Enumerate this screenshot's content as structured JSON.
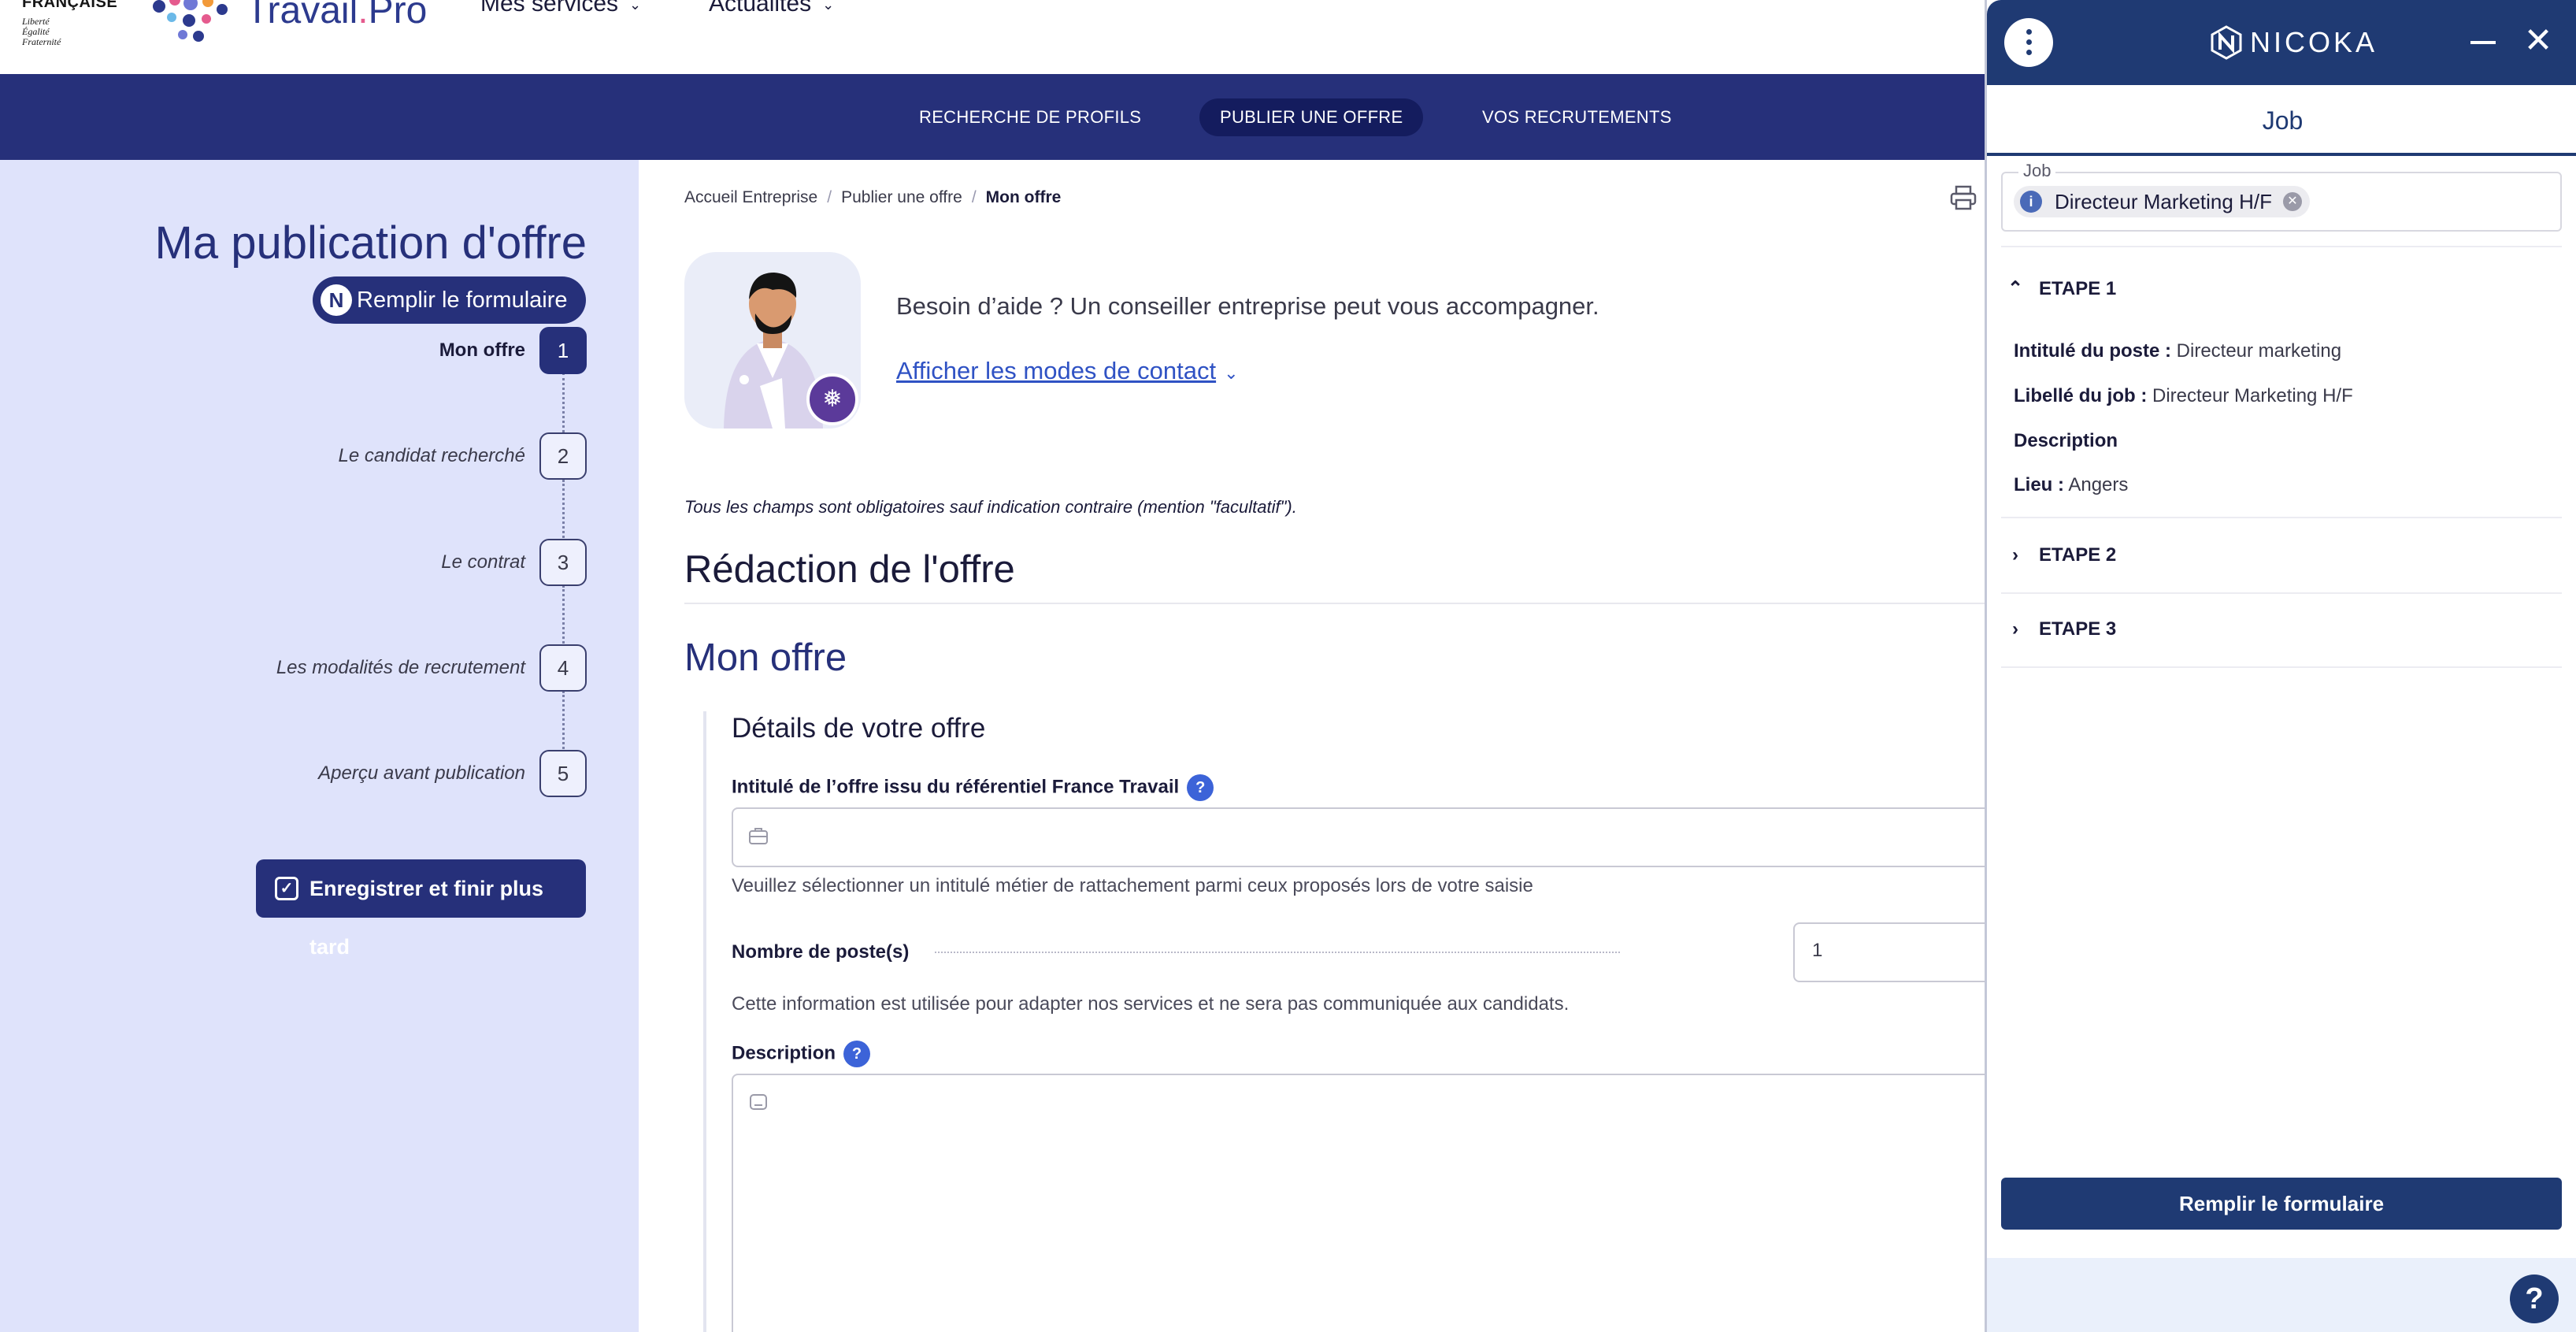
{
  "header": {
    "republic": "FRANÇAISE",
    "motto": [
      "Liberté",
      "Égalité",
      "Fraternité"
    ],
    "logo_text": "Travail",
    "logo_dot": ".",
    "logo_suffix": "Pro",
    "menus": [
      {
        "label": "Mes services"
      },
      {
        "label": "Actualités"
      }
    ]
  },
  "navbar": {
    "items": [
      {
        "label": "RECHERCHE DE PROFILS"
      },
      {
        "label": "PUBLIER UNE OFFRE"
      },
      {
        "label": "VOS RECRUTEMENTS"
      }
    ]
  },
  "sidebar": {
    "title": "Ma publication d'offre",
    "fill_button": "Remplir le formulaire",
    "steps": [
      {
        "label": "Mon offre",
        "num": "1"
      },
      {
        "label": "Le candidat recherché",
        "num": "2"
      },
      {
        "label": "Le contrat",
        "num": "3"
      },
      {
        "label": "Les modalités de recrutement",
        "num": "4"
      },
      {
        "label": "Aperçu avant publication",
        "num": "5"
      }
    ],
    "save_button": "Enregistrer et finir plus tard"
  },
  "main": {
    "breadcrumb": [
      "Accueil Entreprise",
      "Publier une offre",
      "Mon offre"
    ],
    "help_text": "Besoin d’aide ? Un conseiller entreprise peut vous accompagner.",
    "contact_link": "Afficher les modes de contact",
    "mandatory_note": "Tous les champs sont obligatoires sauf indication contraire (mention \"facultatif\").",
    "section_title": "Rédaction de l'offre",
    "subsection_title": "Mon offre",
    "details_title": "Détails de votre offre",
    "fields": {
      "intitule_label": "Intitulé de l’offre issu du référentiel France Travail",
      "intitule_hint": "Veuillez sélectionner un intitulé métier de rattachement parmi ceux proposés lors de votre saisie",
      "postes_label": "Nombre de poste(s)",
      "postes_value": "1",
      "postes_hint": "Cette information est utilisée pour adapter nos services et ne sera pas communiquée aux candidats.",
      "description_label": "Description"
    },
    "help_mark": "?"
  },
  "panel": {
    "brand": "NICOKA",
    "tab": "Job",
    "job_field_label": "Job",
    "job_chip": "Directeur Marketing H/F",
    "etapes": [
      {
        "label": "ETAPE 1",
        "expanded": true
      },
      {
        "label": "ETAPE 2",
        "expanded": false
      },
      {
        "label": "ETAPE 3",
        "expanded": false
      }
    ],
    "details": {
      "intitule_key": "Intitulé du poste :",
      "intitule_val": "Directeur marketing",
      "libelle_key": "Libellé du job :",
      "libelle_val": "Directeur Marketing H/F",
      "description_key": "Description",
      "lieu_key": "Lieu :",
      "lieu_val": "Angers"
    },
    "fill_button": "Remplir le formulaire",
    "help": "?"
  },
  "colors": {
    "navy": "#26307a",
    "sidebar_bg": "#dfe3fb",
    "panel_navy": "#1f3a73",
    "link": "#2f52c4",
    "help_badge": "#3c63d8"
  }
}
